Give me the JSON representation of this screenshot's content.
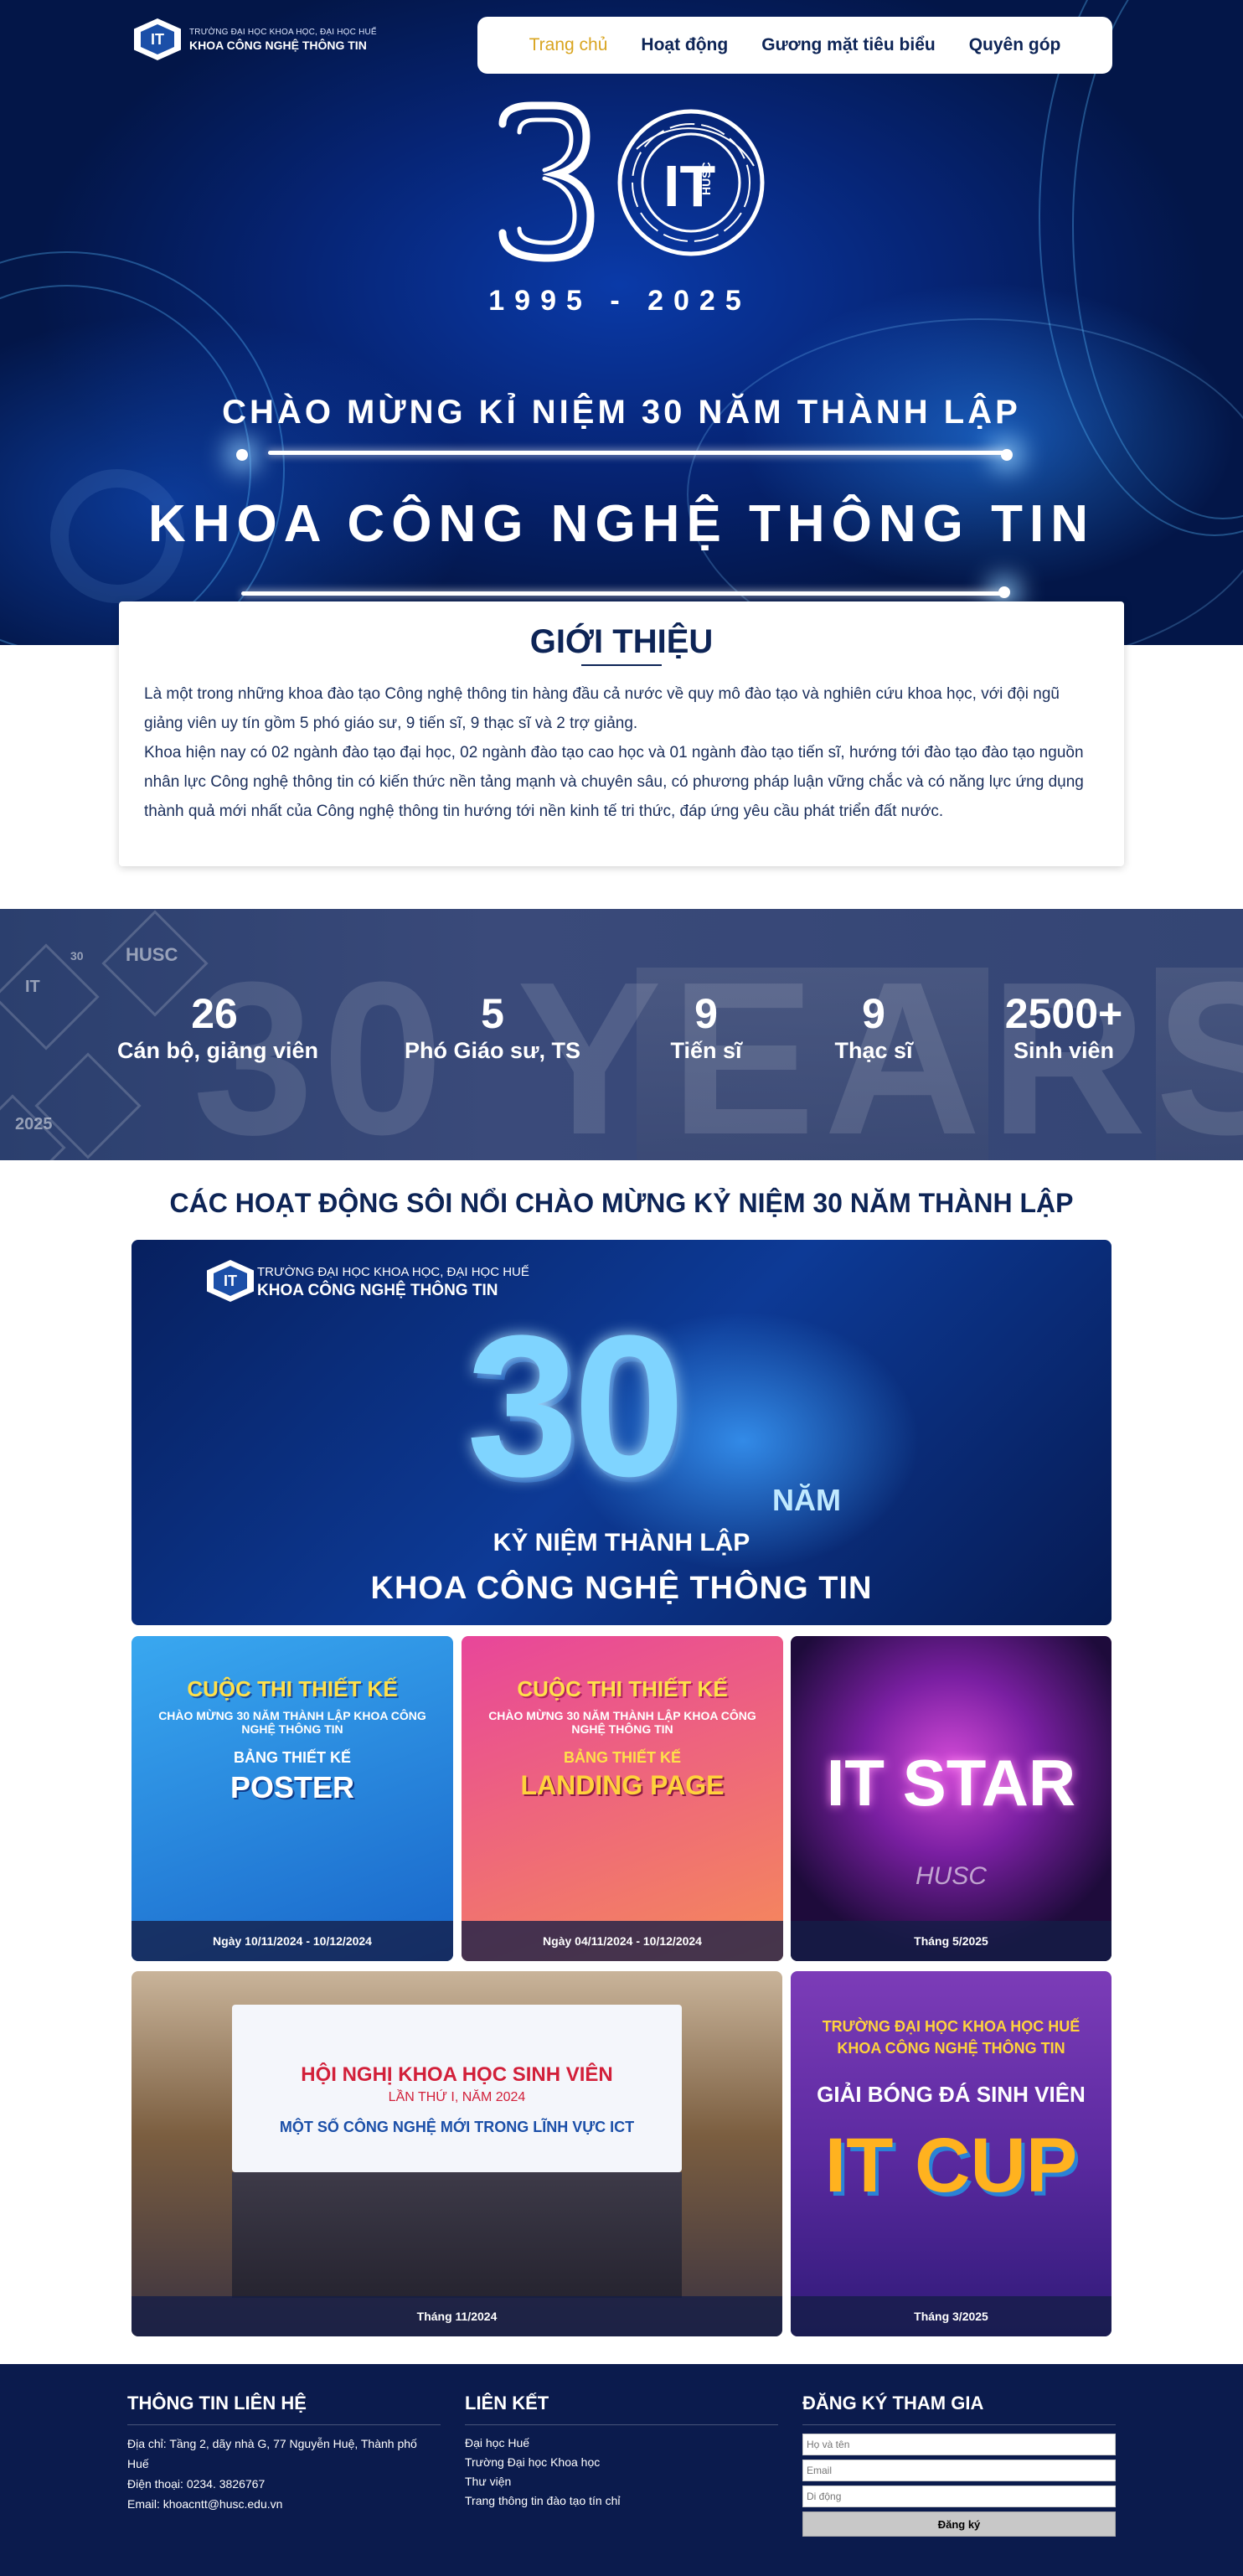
{
  "brand": {
    "line1": "TRƯỜNG ĐẠI HỌC KHOA HỌC, ĐẠI HỌC HUẾ",
    "line2": "KHOA CÔNG NGHỆ THÔNG TIN",
    "mark": "IT"
  },
  "nav": [
    {
      "label": "Trang chủ",
      "active": true
    },
    {
      "label": "Hoạt động"
    },
    {
      "label": "Gương mặt tiêu biểu"
    },
    {
      "label": "Quyên góp"
    }
  ],
  "hero": {
    "logo_number": "30",
    "logo_tag": "HUSC",
    "years": "1995 - 2025",
    "subtitle": "CHÀO MỪNG KỈ NIỆM 30 NĂM THÀNH LẬP",
    "title": "KHOA CÔNG NGHỆ THÔNG TIN"
  },
  "intro": {
    "heading": "GIỚI THIỆU",
    "p1": "Là một trong những khoa đào tạo Công nghệ thông tin hàng đầu cả nước về quy mô đào tạo và nghiên cứu khoa học, với đội ngũ giảng viên uy tín gồm 5 phó giáo sư, 9 tiến sĩ, 9 thạc sĩ và 2 trợ giảng.",
    "p2": "Khoa hiện nay có 02 ngành đào tạo đại học, 02 ngành đào tạo cao học và 01 ngành đào tạo tiến sĩ, hướng tới đào tạo đào tạo nguồn nhân lực Công nghệ thông tin có kiến thức nền tảng mạnh và chuyên sâu, có phương pháp luận vững chắc và có năng lực ứng dụng thành quả mới nhất của Công nghệ thông tin hướng tới nền kinh tế tri thức, đáp ứng yêu cầu phát triển đất nước."
  },
  "stats": {
    "bg_text": "30 YEARS IT",
    "tags": [
      "IT",
      "30",
      "HUSC",
      "2025"
    ],
    "items": [
      {
        "value": "26",
        "label": "Cán bộ, giảng viên"
      },
      {
        "value": "5",
        "label": "Phó Giáo sư, TS"
      },
      {
        "value": "9",
        "label": "Tiến sĩ"
      },
      {
        "value": "9",
        "label": "Thạc sĩ"
      },
      {
        "value": "2500+",
        "label": "Sinh viên"
      }
    ]
  },
  "activities": {
    "heading": "CÁC HOẠT ĐỘNG SÔI NỔI CHÀO MỪNG KỶ NIỆM 30 NĂM THÀNH LẬP",
    "banner": {
      "line1": "TRƯỜNG ĐẠI HỌC KHOA HỌC, ĐẠI HỌC HUẾ",
      "line2": "KHOA CÔNG NGHỆ THÔNG TIN",
      "big": "30",
      "nam": "NĂM",
      "sub": "KỶ NIỆM THÀNH LẬP",
      "main": "KHOA CÔNG NGHỆ THÔNG TIN"
    },
    "cards": [
      {
        "caption": "Ngày 10/11/2024 - 10/12/2024",
        "t1": "CUỘC THI THIẾT KẾ",
        "t2": "CHÀO MỪNG 30 NĂM THÀNH LẬP KHOA CÔNG NGHỆ THÔNG TIN",
        "t3": "BẢNG THIẾT KẾ",
        "t4": "POSTER"
      },
      {
        "caption": "Ngày 04/11/2024 - 10/12/2024",
        "t1": "CUỘC THI THIẾT KẾ",
        "t2": "CHÀO MỪNG 30 NĂM THÀNH LẬP KHOA CÔNG NGHỆ THÔNG TIN",
        "t3": "BẢNG THIẾT KẾ",
        "t4": "LANDING PAGE"
      },
      {
        "caption": "Tháng 5/2025",
        "t1": "IT STAR",
        "t2": "HUSC"
      },
      {
        "caption": "Tháng 11/2024",
        "t1": "HỘI NGHỊ KHOA HỌC SINH VIÊN",
        "t2": "LẦN THỨ I, NĂM 2024",
        "t3": "MỘT SỐ CÔNG NGHỆ MỚI TRONG LĨNH VỰC ICT"
      },
      {
        "caption": "Tháng 3/2025",
        "t1": "TRƯỜNG ĐẠI HỌC KHOA HỌC HUẾ",
        "t2": "KHOA CÔNG NGHỆ THÔNG TIN",
        "t3": "GIẢI BÓNG ĐÁ SINH VIÊN",
        "t4": "IT CUP"
      }
    ]
  },
  "footer": {
    "contact": {
      "heading": "THÔNG TIN LIÊN HỆ",
      "address": "Địa chỉ: Tầng 2, dãy nhà G, 77 Nguyễn Huệ, Thành phố Huế",
      "phone": "Điện thoại: 0234. 3826767",
      "email": "Email: khoacntt@husc.edu.vn"
    },
    "links": {
      "heading": "LIÊN KẾT",
      "items": [
        "Đại học Huế",
        "Trường Đại học Khoa học",
        "Thư viện",
        "Trang thông tin đào tạo tín chỉ"
      ]
    },
    "register": {
      "heading": "ĐĂNG KÝ THAM GIA",
      "name_placeholder": "Họ và tên",
      "email_placeholder": "Email",
      "phone_placeholder": "Di động",
      "button": "Đăng ký"
    }
  }
}
